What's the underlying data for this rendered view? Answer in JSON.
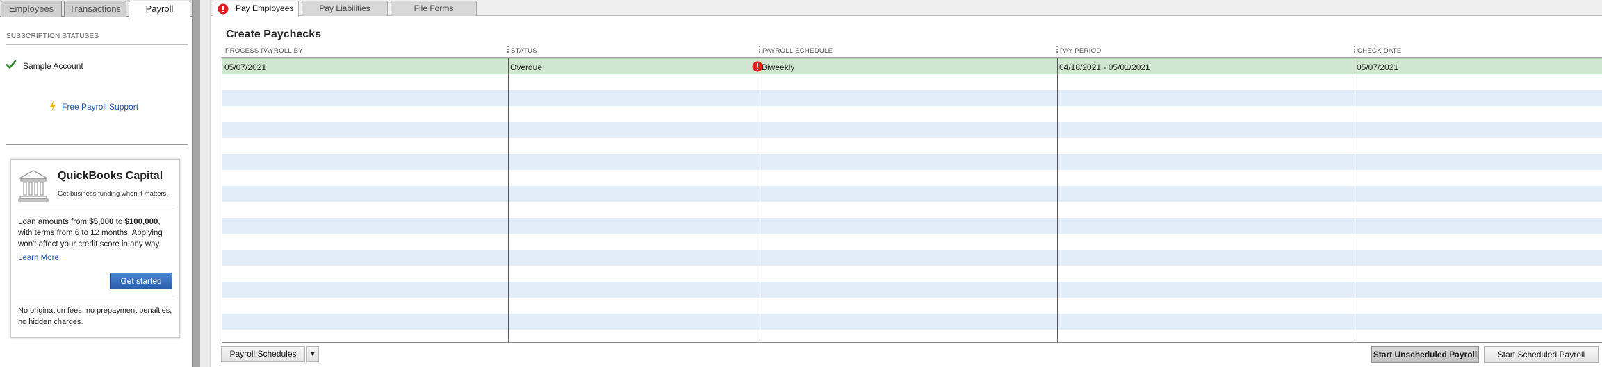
{
  "left_tabs": [
    {
      "label": "Employees",
      "active": false
    },
    {
      "label": "Transactions",
      "active": false
    },
    {
      "label": "Payroll",
      "active": true
    }
  ],
  "subscription": {
    "heading": "SUBSCRIPTION STATUSES",
    "account": "Sample Account",
    "support_link": "Free Payroll Support"
  },
  "capital": {
    "title": "QuickBooks Capital",
    "subtitle": "Get business funding when it matters.",
    "body_pre": "Loan amounts from ",
    "amount_min": "$5,000",
    "body_mid": " to ",
    "amount_max": "$100,000",
    "body_post": ", with terms from 6 to 12 months. Applying won't affect your credit score in any way.",
    "learn_more": "Learn More",
    "cta": "Get started",
    "footer": "No origination fees, no prepayment penalties, no hidden charges."
  },
  "main_tabs": [
    {
      "label": "Pay Employees",
      "active": true,
      "warning": true
    },
    {
      "label": "Pay Liabilities",
      "active": false
    },
    {
      "label": "File Forms",
      "active": false
    }
  ],
  "section_title": "Create Paychecks",
  "grid": {
    "columns": [
      "PROCESS PAYROLL BY",
      "STATUS",
      "PAYROLL SCHEDULE",
      "PAY PERIOD",
      "CHECK DATE"
    ],
    "rows": [
      {
        "process_by": "05/07/2021",
        "status": "Overdue",
        "schedule": "Biweekly",
        "pay_period": "04/18/2021 - 05/01/2021",
        "check_date": "05/07/2021",
        "selected": true
      }
    ]
  },
  "buttons": {
    "schedules": "Payroll Schedules",
    "unscheduled": "Start Unscheduled Payroll",
    "scheduled": "Start Scheduled Payroll"
  },
  "colors": {
    "selected_row": "#cfe7cf",
    "alt_row": "#e3edf9",
    "link": "#1e56a8",
    "warning": "#e02020",
    "cta": "#2a5eaa"
  },
  "icons": {
    "check": "check-icon",
    "support": "lightning-bolt-icon",
    "bank": "bank-building-icon",
    "warning": "warning-exclamation-icon"
  }
}
